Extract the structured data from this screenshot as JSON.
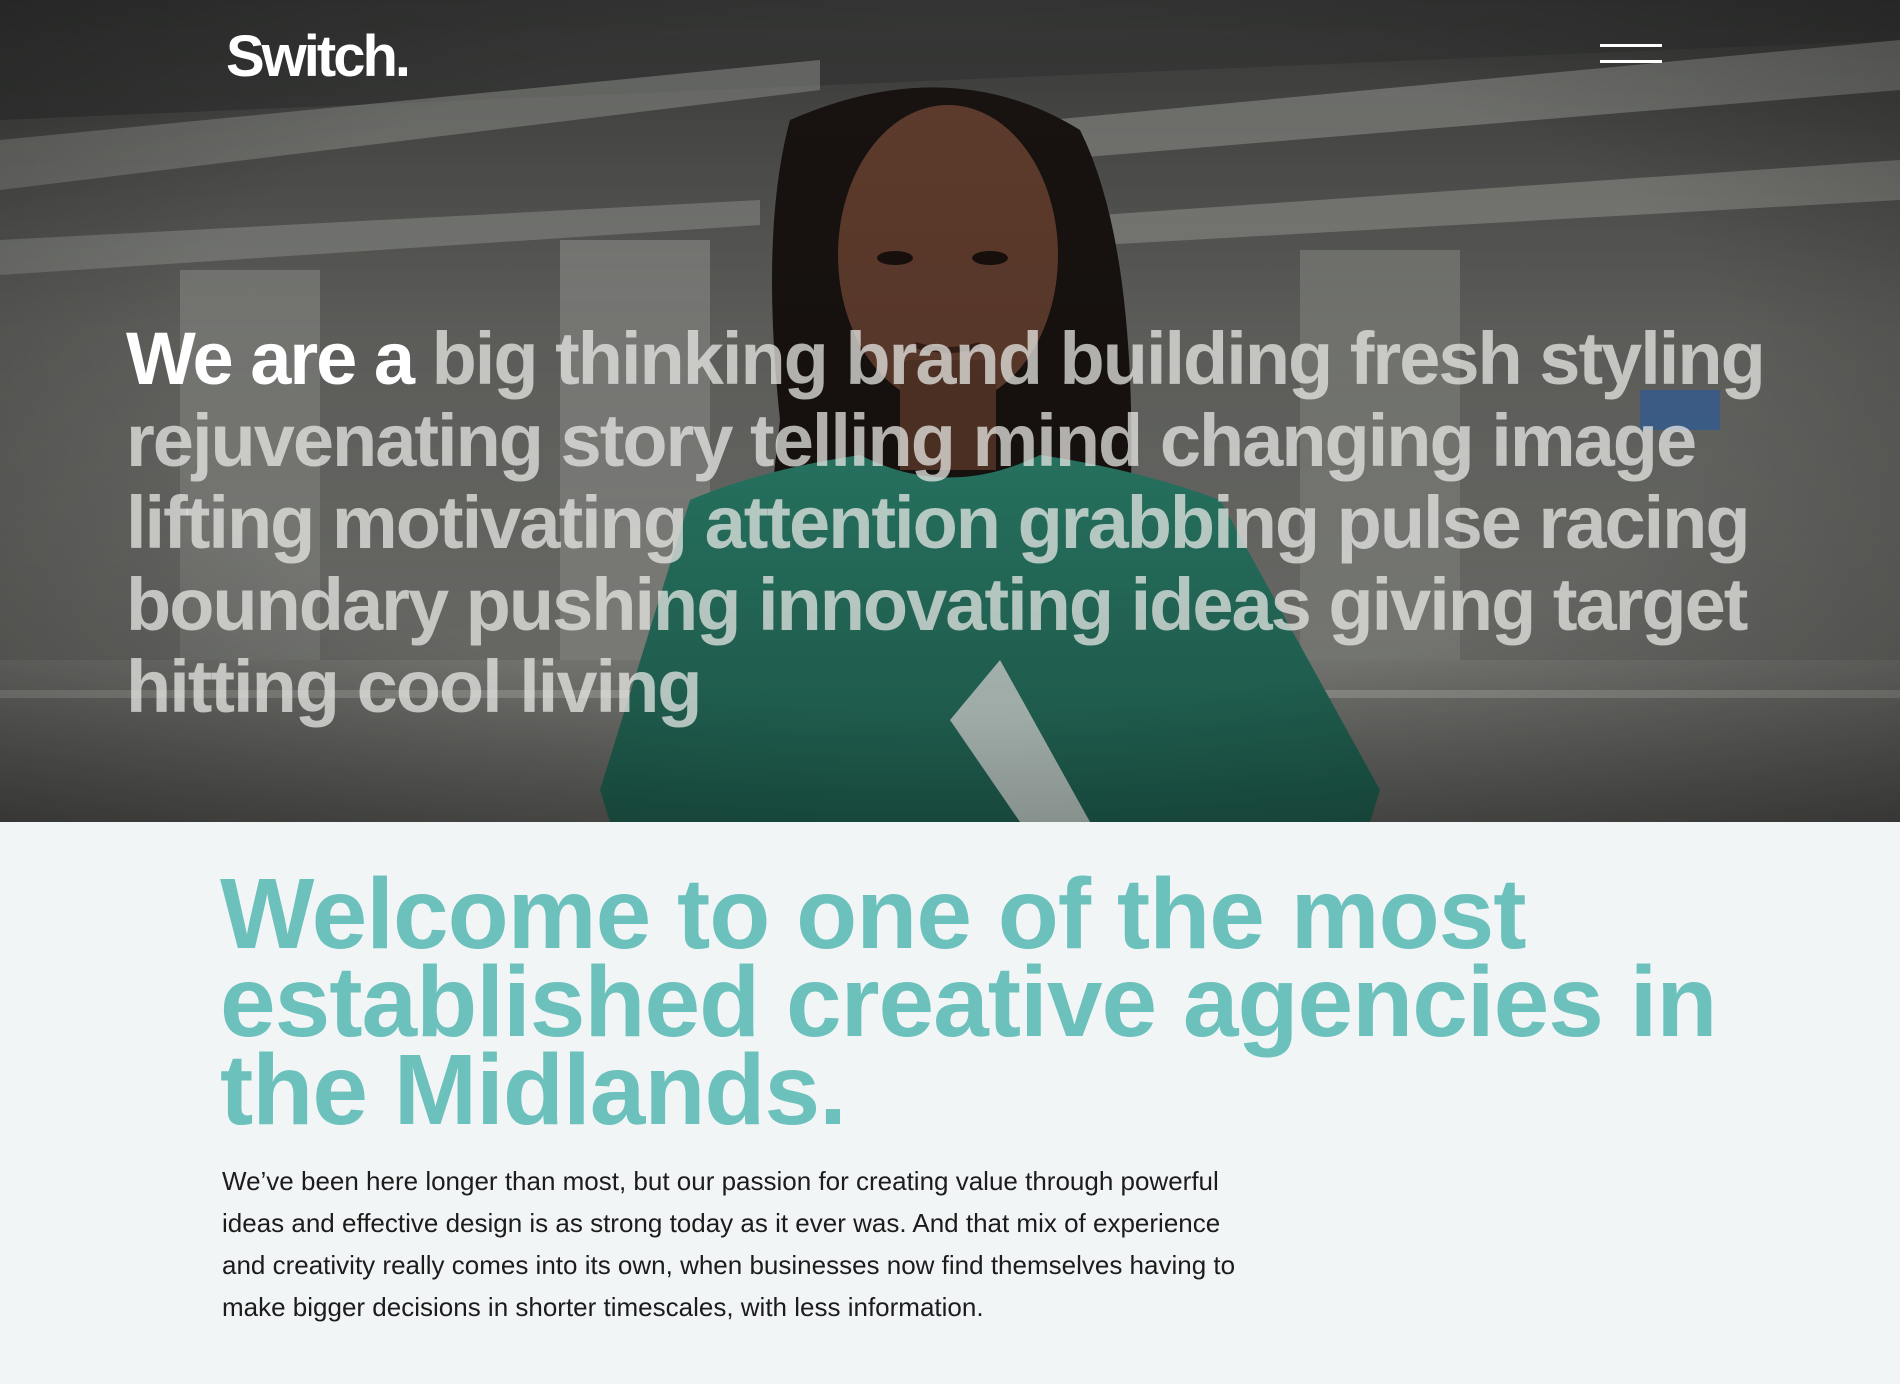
{
  "header": {
    "logo_text": "Switch.",
    "menu_icon": "hamburger-menu-icon"
  },
  "hero": {
    "background": "video-still-woman-in-green-tshirt",
    "tagline_lead": "We are a",
    "tagline_rest": "big thinking brand building fresh styling rejuvenating story telling mind changing image lifting motivating attention grabbing pulse racing boundary pushing innovating ideas giving target hitting cool living"
  },
  "welcome": {
    "title": "Welcome to one of the most established creative agencies in the Midlands.",
    "body": "We’ve been here longer than most, but our passion for creating value through powerful ideas and effective design is as strong today as it ever was. And that mix of experience and creativity really comes into its own, when businesses now find themselves having to make bigger decisions in shorter timescales, with less information."
  },
  "colors": {
    "accent": "#6cc1bc",
    "section_bg": "#f2f5f6",
    "body_text": "#1c1c1c",
    "hero_text": "#ffffff"
  }
}
